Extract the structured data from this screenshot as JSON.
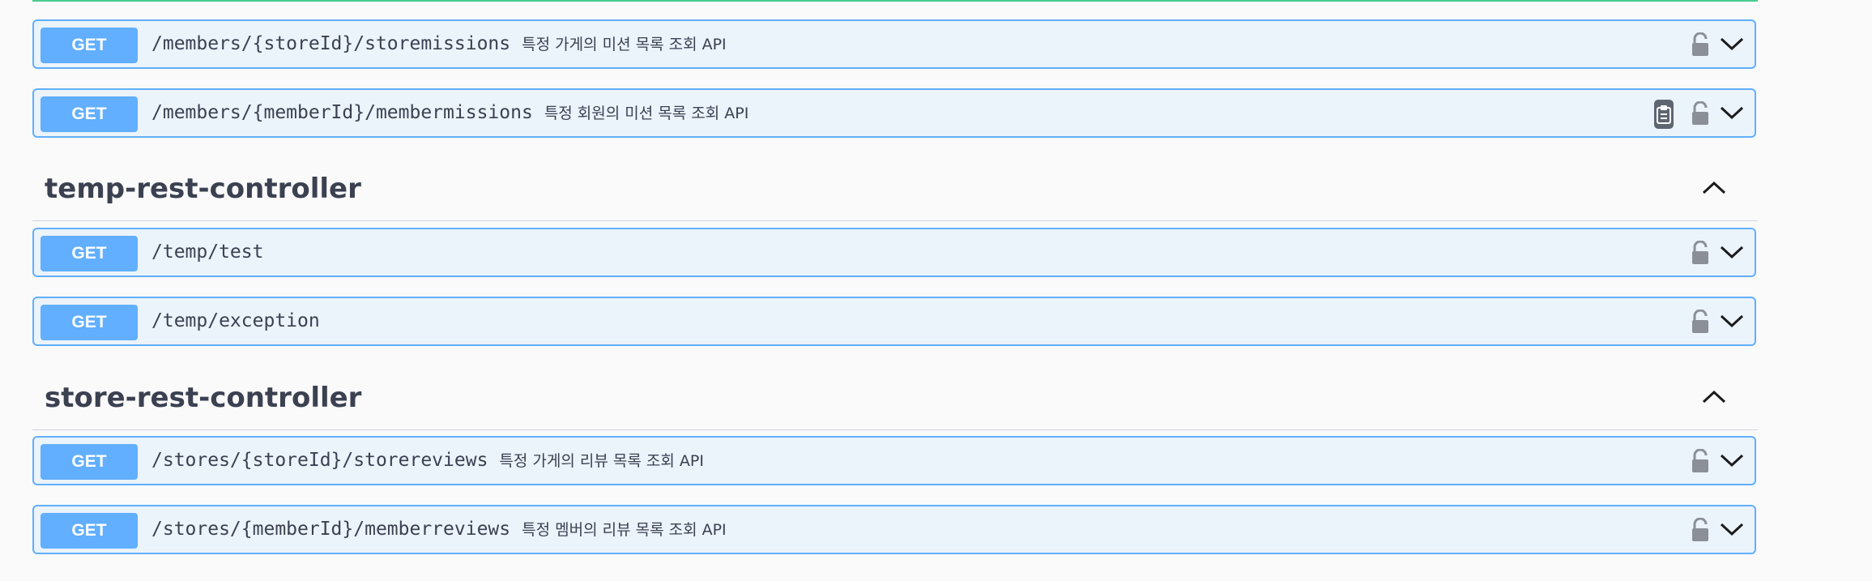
{
  "sections": [
    {
      "operations": [
        {
          "method": "GET",
          "path": "/members/{storeId}/storemissions",
          "summary": "특정 가게의 미션 목록 조회 API"
        },
        {
          "method": "GET",
          "path": "/members/{memberId}/membermissions",
          "summary": "특정 회원의 미션 목록 조회 API"
        }
      ]
    },
    {
      "title": "temp-rest-controller",
      "operations": [
        {
          "method": "GET",
          "path": "/temp/test",
          "summary": ""
        },
        {
          "method": "GET",
          "path": "/temp/exception",
          "summary": ""
        }
      ]
    },
    {
      "title": "store-rest-controller",
      "operations": [
        {
          "method": "GET",
          "path": "/stores/{storeId}/storereviews",
          "summary": "특정 가게의 리뷰 목록 조회 API"
        },
        {
          "method": "GET",
          "path": "/stores/{memberId}/memberreviews",
          "summary": "특정 멤버의 리뷰 목록 조회 API"
        }
      ]
    }
  ],
  "icons": {
    "lock": "lock-icon",
    "expand": "chevron-down-icon",
    "collapse": "chevron-up-icon",
    "copy": "clipboard-icon"
  },
  "colors": {
    "get_accent": "#61affe",
    "get_background": "#ebf3fb",
    "post_edge": "#49cc90",
    "text": "#3b4151"
  }
}
